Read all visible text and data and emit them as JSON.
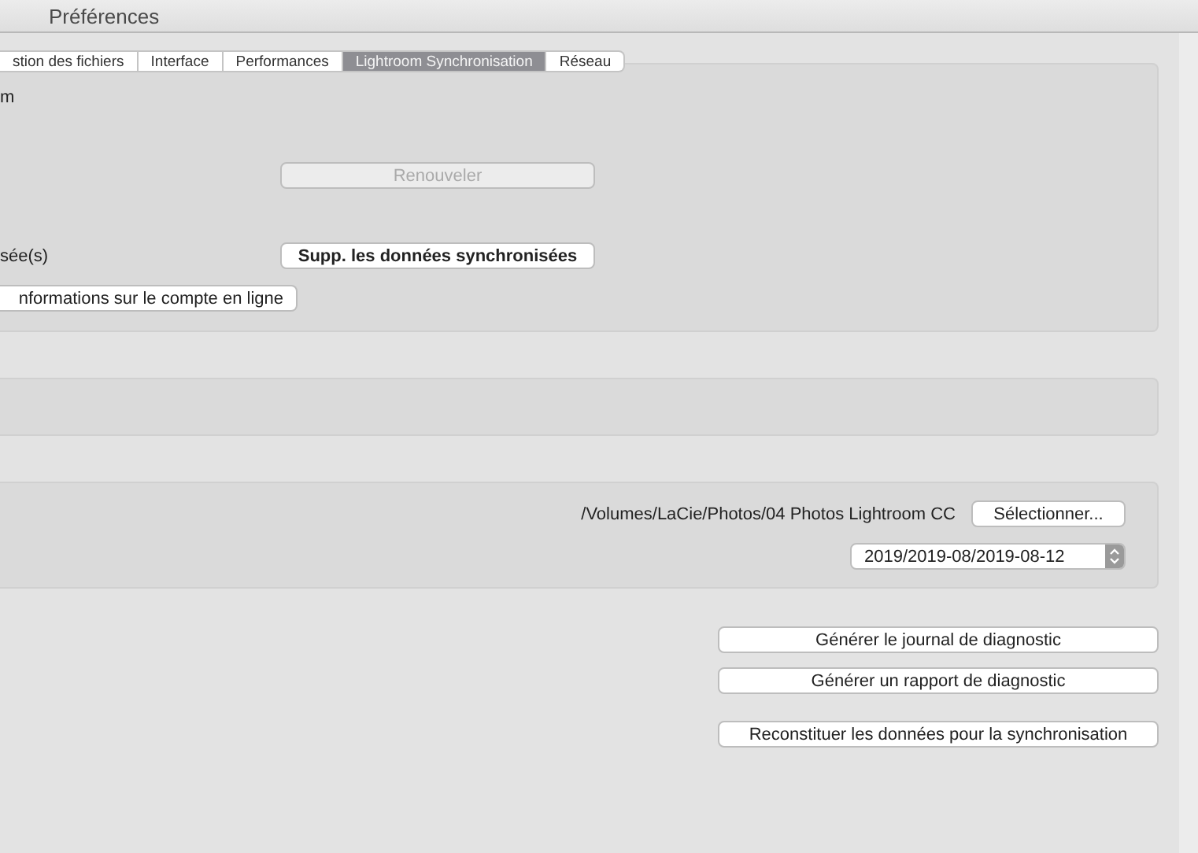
{
  "window": {
    "title": "Préférences"
  },
  "tabs": [
    {
      "label": "stion des fichiers",
      "selected": false
    },
    {
      "label": "Interface",
      "selected": false
    },
    {
      "label": "Performances",
      "selected": false
    },
    {
      "label": "Lightroom Synchronisation",
      "selected": true
    },
    {
      "label": "Réseau",
      "selected": false
    }
  ],
  "account": {
    "label": "m",
    "renew_button": {
      "label": "Renouveler",
      "disabled": true
    },
    "synced_label": "sée(s)",
    "delete_button": {
      "label": "Supp. les données synchronisées",
      "disabled": false
    },
    "info_button": "nformations sur le compte en ligne"
  },
  "location": {
    "path": "/Volumes/LaCie/Photos/04 Photos Lightroom CC",
    "choose_button": "Sélectionner...",
    "folder_format": "2019/2019-08/2019-08-12"
  },
  "diagnostics": {
    "buttons": [
      "Générer le journal de diagnostic",
      "Générer un rapport de diagnostic"
    ],
    "rebuild_button": "Reconstituer les données pour la synchronisation"
  }
}
